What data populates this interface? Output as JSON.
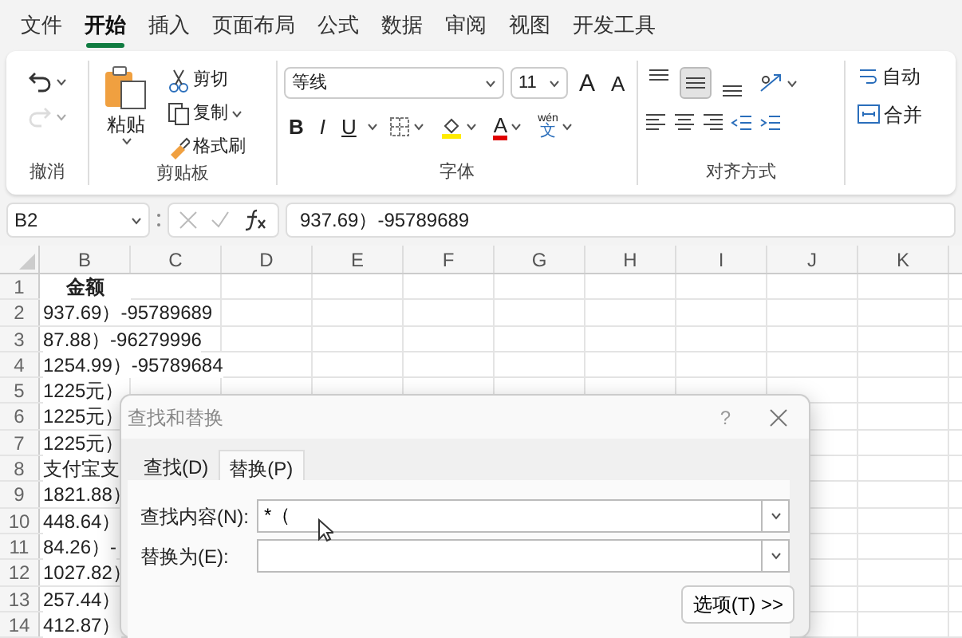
{
  "menu_tabs": [
    {
      "label": "文件",
      "selected": false
    },
    {
      "label": "开始",
      "selected": true
    },
    {
      "label": "插入",
      "selected": false
    },
    {
      "label": "页面布局",
      "selected": false
    },
    {
      "label": "公式",
      "selected": false
    },
    {
      "label": "数据",
      "selected": false
    },
    {
      "label": "审阅",
      "selected": false
    },
    {
      "label": "视图",
      "selected": false
    },
    {
      "label": "开发工具",
      "selected": false
    }
  ],
  "ribbon": {
    "undo_group": {
      "label": "撤消",
      "undo": {
        "disabled": false
      },
      "redo": {
        "disabled": true
      }
    },
    "clipboard": {
      "label": "剪贴板",
      "paste": "粘贴",
      "cut": "剪切",
      "copy": "复制",
      "format_painter": "格式刷"
    },
    "font": {
      "label": "字体",
      "font_name": "等线",
      "font_size": "11",
      "grow": "A",
      "shrink": "A",
      "bold": "B",
      "italic": "I",
      "underline": "U",
      "font_color": "A",
      "phonetic_top": "wén",
      "phonetic_char": "文"
    },
    "alignment": {
      "label": "对齐方式",
      "vertical": [
        {
          "kind": "top",
          "selected": false
        },
        {
          "kind": "middle",
          "selected": true
        },
        {
          "kind": "bottom",
          "selected": false
        }
      ]
    },
    "wrap_text": "自动",
    "merge": "合并"
  },
  "formula_bar": {
    "name_box": "B2",
    "formula": "937.69）-95789689"
  },
  "sheet": {
    "columns": [
      "B",
      "C",
      "D",
      "E",
      "F",
      "G",
      "H",
      "I",
      "J",
      "K"
    ],
    "rows": [
      {
        "number": "1",
        "kind": "header",
        "value": "金额"
      },
      {
        "number": "2",
        "kind": "value",
        "value": "937.69）-95789689"
      },
      {
        "number": "3",
        "kind": "value",
        "value": "87.88）-96279996"
      },
      {
        "number": "4",
        "kind": "value",
        "value": "1254.99）-95789684"
      },
      {
        "number": "5",
        "kind": "value",
        "value": "1225元）"
      },
      {
        "number": "6",
        "kind": "value",
        "value": "1225元）"
      },
      {
        "number": "7",
        "kind": "value",
        "value": "1225元）"
      },
      {
        "number": "8",
        "kind": "value",
        "value": "支付宝支"
      },
      {
        "number": "9",
        "kind": "value",
        "value": "1821.88）"
      },
      {
        "number": "10",
        "kind": "value",
        "value": "448.64）"
      },
      {
        "number": "11",
        "kind": "value",
        "value": "84.26）-"
      },
      {
        "number": "12",
        "kind": "value",
        "value": "1027.82）"
      },
      {
        "number": "13",
        "kind": "value",
        "value": "257.44）"
      },
      {
        "number": "14",
        "kind": "value",
        "value": "412.87）"
      }
    ]
  },
  "dialog": {
    "title": "查找和替换",
    "help": "?",
    "tabs": [
      {
        "label": "查找(D)",
        "selected": false
      },
      {
        "label": "替换(P)",
        "selected": true
      }
    ],
    "fields": [
      {
        "label": "查找内容(N):",
        "value": "*（"
      },
      {
        "label": "替换为(E):"
      }
    ],
    "options_button": {
      "label": "选项(T) >>"
    }
  }
}
